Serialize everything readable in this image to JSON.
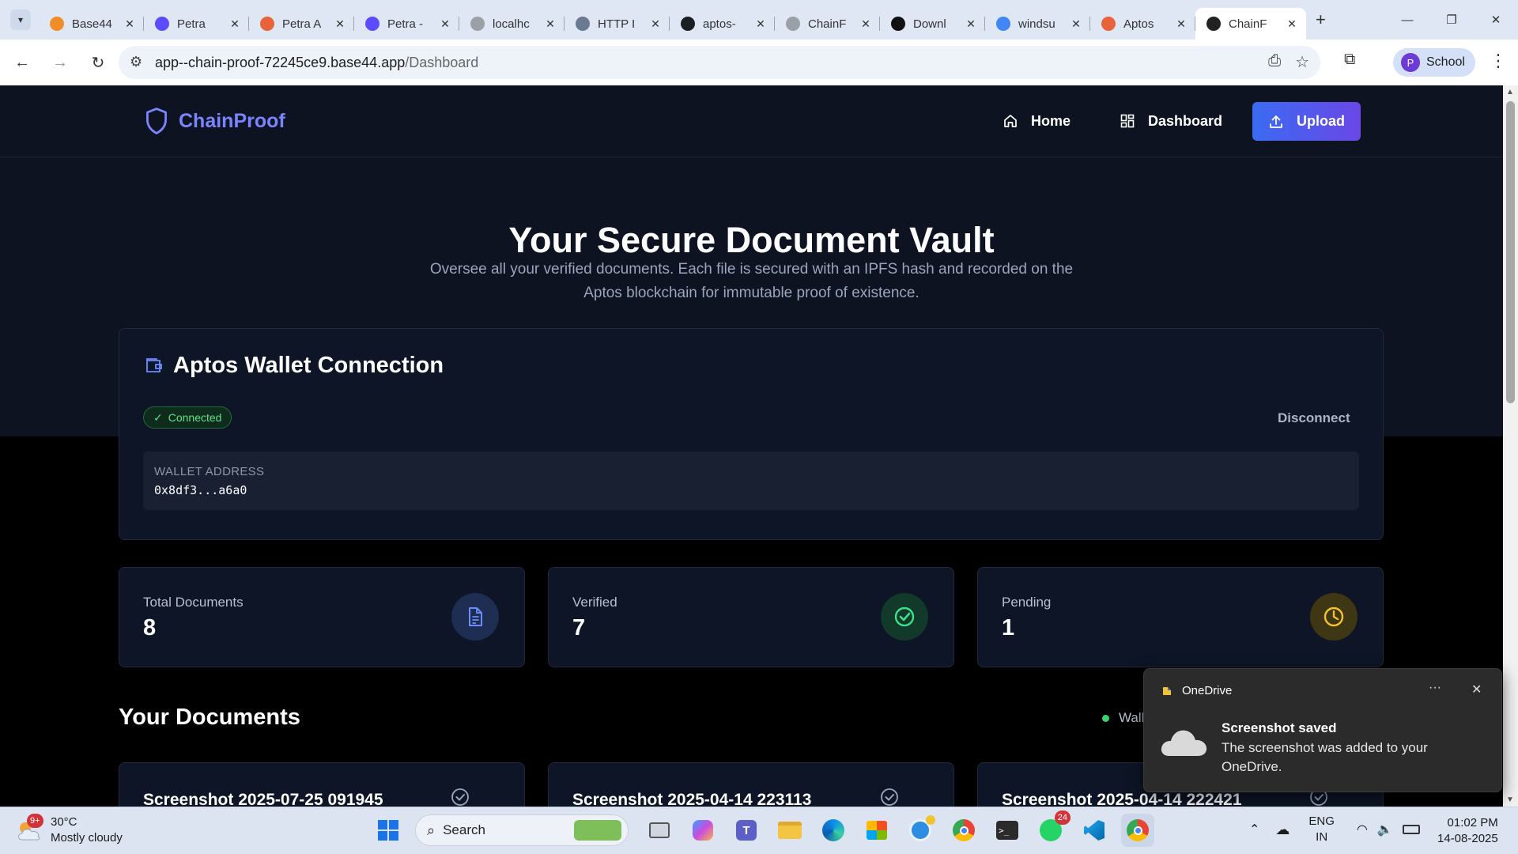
{
  "browser": {
    "tabs": [
      {
        "title": "Base44",
        "color": "#f28c28"
      },
      {
        "title": "Petra",
        "color": "#5b4dff"
      },
      {
        "title": "Petra A",
        "color": "#e8623c"
      },
      {
        "title": "Petra -",
        "color": "#5b4dff"
      },
      {
        "title": "localhc",
        "color": "#9aa0a6"
      },
      {
        "title": "HTTP I",
        "color": "#6b7a90"
      },
      {
        "title": "aptos-",
        "color": "#1b1f23"
      },
      {
        "title": "ChainF",
        "color": "#9aa0a6"
      },
      {
        "title": "Downl",
        "color": "#111111"
      },
      {
        "title": "windsu",
        "color": "#4285f4"
      },
      {
        "title": "Aptos",
        "color": "#e8623c"
      },
      {
        "title": "ChainF",
        "color": "#222222"
      }
    ],
    "url_host": "app--chain-proof-72245ce9.base44.app",
    "url_path": "/Dashboard",
    "profile_initial": "P",
    "profile_name": "School"
  },
  "app": {
    "brand": "ChainProof",
    "nav": {
      "home": "Home",
      "dashboard": "Dashboard",
      "upload": "Upload"
    },
    "hero": {
      "title": "Your Secure Document Vault",
      "subtitle": "Oversee all your verified documents. Each file is secured with an IPFS hash and recorded on the Aptos blockchain for immutable proof of existence."
    },
    "wallet": {
      "title": "Aptos Wallet Connection",
      "status": "Connected",
      "disconnect": "Disconnect",
      "address_label": "WALLET ADDRESS",
      "address": "0x8df3...a6a0"
    },
    "stats": [
      {
        "label": "Total Documents",
        "value": "8",
        "icon": "document-icon",
        "tint": "#1d2e52",
        "color": "#6d8dff"
      },
      {
        "label": "Verified",
        "value": "7",
        "icon": "check-circle-icon",
        "tint": "#123a2a",
        "color": "#3fe08a"
      },
      {
        "label": "Pending",
        "value": "1",
        "icon": "clock-icon",
        "tint": "#3f3614",
        "color": "#f2c230"
      }
    ],
    "documents_title": "Your Documents",
    "wallet_legend": "Wall",
    "documents": [
      {
        "title": "Screenshot 2025-07-25 091945"
      },
      {
        "title": "Screenshot 2025-04-14 223113"
      },
      {
        "title": "Screenshot 2025-04-14 222421"
      }
    ]
  },
  "notification": {
    "app": "OneDrive",
    "more": "···",
    "heading": "Screenshot saved",
    "body": "The screenshot was added to your OneDrive."
  },
  "taskbar": {
    "weather_badge": "9+",
    "temperature": "30°C",
    "condition": "Mostly cloudy",
    "search": "Search",
    "whatsapp_badge": "24",
    "lang_1": "ENG",
    "lang_2": "IN",
    "time": "01:02 PM",
    "date": "14-08-2025"
  }
}
